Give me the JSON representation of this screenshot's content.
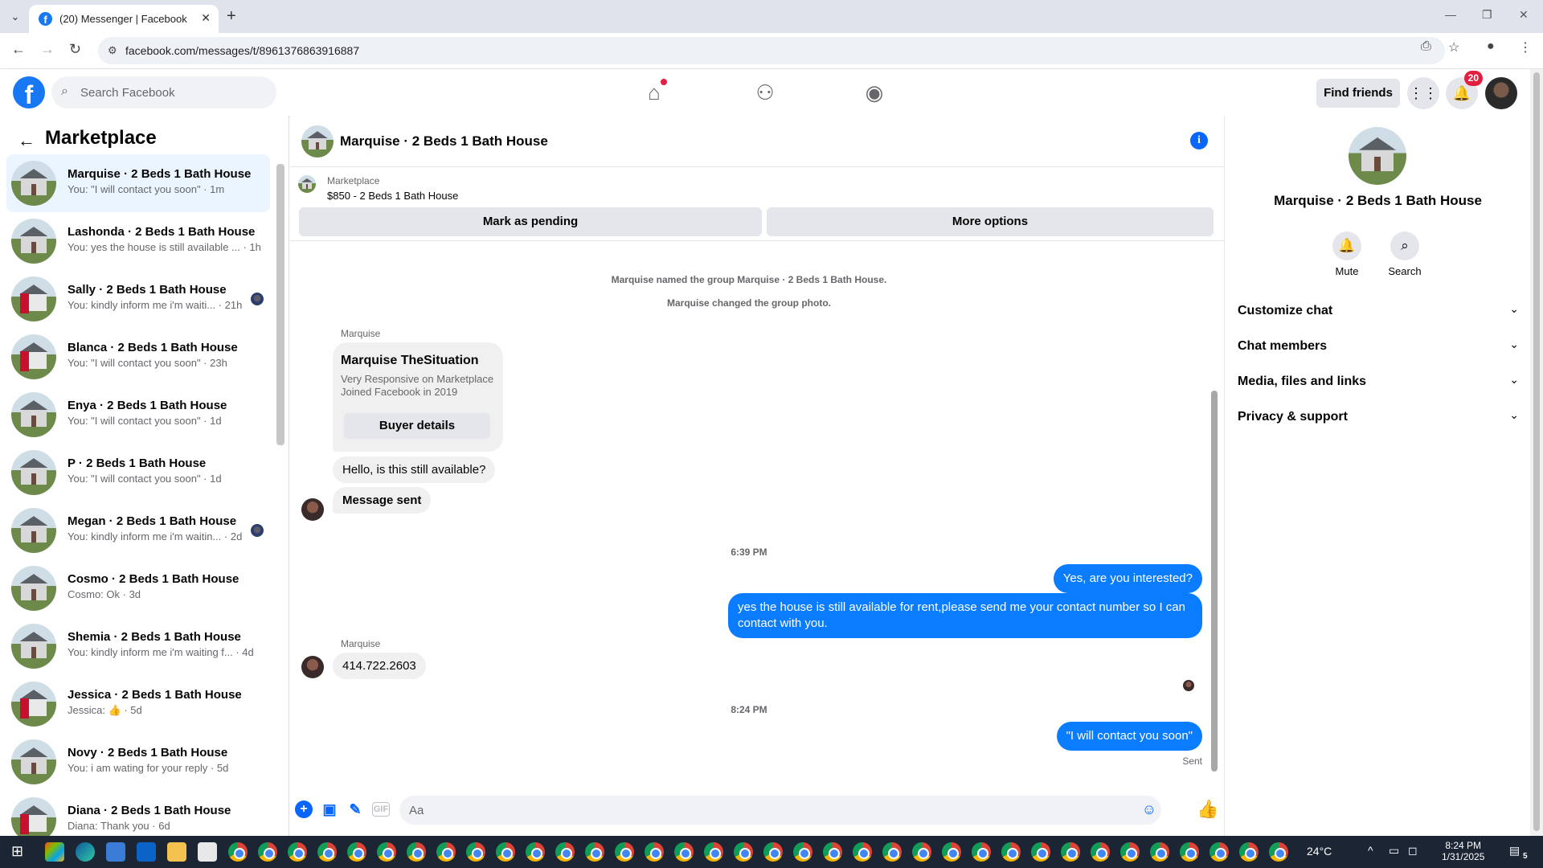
{
  "browser": {
    "tab_title": "(20) Messenger | Facebook",
    "url": "facebook.com/messages/t/8961376863916887",
    "new_tab_label": "+"
  },
  "header": {
    "search_placeholder": "Search Facebook",
    "find_friends_label": "Find friends",
    "notification_count": "20"
  },
  "sidebar": {
    "title": "Marketplace",
    "conversations": [
      {
        "name": "Marquise · 2 Beds 1 Bath House",
        "snippet": "You: \"I will contact you soon\" · 1m",
        "thumb": "house",
        "active": true
      },
      {
        "name": "Lashonda · 2 Beds 1 Bath House",
        "snippet": "You: yes the house is still available ... · 1h",
        "thumb": "house"
      },
      {
        "name": "Sally · 2 Beds 1 Bath House",
        "snippet": "You: kindly inform me i'm waiti... · 21h",
        "thumb": "house-red",
        "seen": true
      },
      {
        "name": "Blanca · 2 Beds 1 Bath House",
        "snippet": "You: \"I will contact you soon\" · 23h",
        "thumb": "house-red"
      },
      {
        "name": "Enya · 2 Beds 1 Bath House",
        "snippet": "You: \"I will contact you soon\" · 1d",
        "thumb": "house"
      },
      {
        "name": "P · 2 Beds 1 Bath House",
        "snippet": "You: \"I will contact you soon\" · 1d",
        "thumb": "house"
      },
      {
        "name": "Megan · 2 Beds 1 Bath House",
        "snippet": "You: kindly inform me i'm waitin... · 2d",
        "thumb": "house",
        "seen": true
      },
      {
        "name": "Cosmo · 2 Beds 1 Bath House",
        "snippet": "Cosmo: Ok · 3d",
        "thumb": "house"
      },
      {
        "name": "Shemia · 2 Beds 1 Bath House",
        "snippet": "You: kindly inform me i'm waiting f... · 4d",
        "thumb": "house"
      },
      {
        "name": "Jessica · 2 Beds 1 Bath House",
        "snippet": "Jessica: 👍 · 5d",
        "thumb": "house-red"
      },
      {
        "name": "Novy · 2 Beds 1 Bath House",
        "snippet": "You: i am wating for your reply · 5d",
        "thumb": "house"
      },
      {
        "name": "Diana · 2 Beds 1 Bath House",
        "snippet": "Diana: Thank you · 6d",
        "thumb": "house-red"
      }
    ]
  },
  "chat": {
    "title": "Marquise · 2 Beds 1 Bath House",
    "listing_category": "Marketplace",
    "listing_price": "$850 - 2 Beds 1 Bath House",
    "mark_pending_label": "Mark as pending",
    "more_options_label": "More options",
    "system_1": "Marquise named the group Marquise · 2 Beds 1 Bath House.",
    "system_2": "Marquise changed the group photo.",
    "sender_1": "Marquise",
    "card_name": "Marquise TheSituation",
    "card_line_1": "Very Responsive on Marketplace",
    "card_line_2": "Joined Facebook in 2019",
    "card_button": "Buyer details",
    "msg_in_1": "Hello, is this still available?",
    "msg_in_2": "Message sent",
    "time_1": "6:39 PM",
    "msg_out_1": "Yes, are you interested?",
    "msg_out_2": "yes the house is still available for rent,please send me your contact number so I can contact with you.",
    "sender_2": "Marquise",
    "msg_in_3": "414.722.2603",
    "time_2": "8:24 PM",
    "msg_out_3": "\"I will contact you soon\"",
    "status": "Sent",
    "composer_placeholder": "Aa"
  },
  "right_panel": {
    "name": "Marquise · 2 Beds 1 Bath House",
    "mute_label": "Mute",
    "search_label": "Search",
    "sections": [
      "Customize chat",
      "Chat members",
      "Media, files and links",
      "Privacy & support"
    ]
  },
  "taskbar": {
    "temperature": "24°C",
    "time": "8:24 PM",
    "date": "1/31/2025",
    "notif_count": "5"
  },
  "colors": {
    "brand": "#1877f2",
    "outgoing_bubble": "#0a7cff",
    "badge": "#e41e3f"
  }
}
